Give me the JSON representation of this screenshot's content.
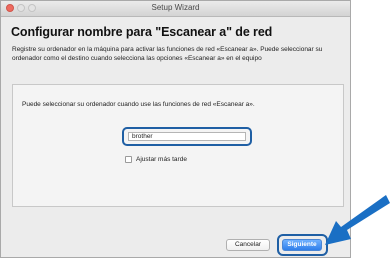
{
  "window": {
    "title": "Setup Wizard"
  },
  "page": {
    "heading": "Configurar nombre para \"Escanear a\" de red",
    "description": "Registre su ordenador en la máquina para activar las funciones de red «Escanear a». Puede seleccionar su ordenador como el destino cuando selecciona las opciones «Escanear a» en el equipo"
  },
  "panel": {
    "text": "Puede seleccionar su ordenador cuando use las funciones de red «Escanear a».",
    "name_field": {
      "value": "brother"
    },
    "checkbox": {
      "label": "Ajustar más tarde",
      "checked": false
    }
  },
  "buttons": {
    "cancel": "Cancelar",
    "next": "Siguiente"
  },
  "colors": {
    "highlight": "#1f5fa4",
    "arrow": "#1a6fc4",
    "primary_button": "#2f7fea"
  }
}
